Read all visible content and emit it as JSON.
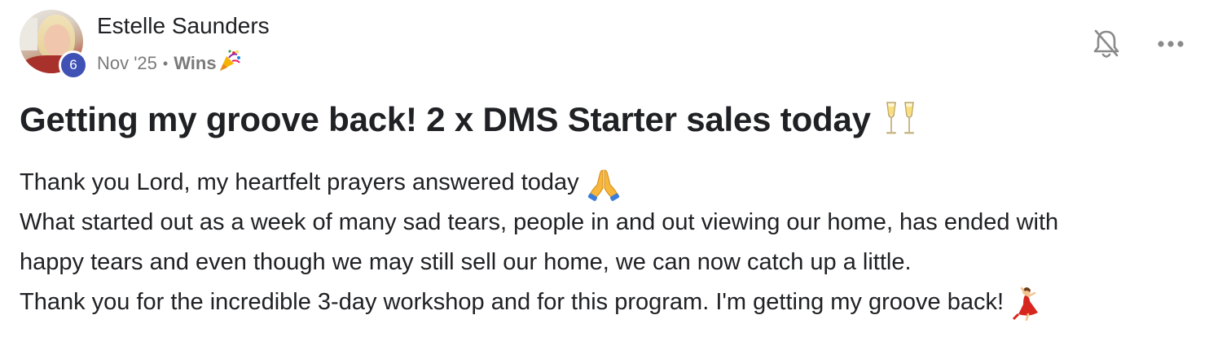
{
  "post": {
    "author": {
      "name": "Estelle Saunders",
      "level": "6"
    },
    "meta": {
      "date": "Nov '25",
      "separator": "•",
      "category": "Wins",
      "category_icon": "party-popper-icon"
    },
    "actions": {
      "notify_icon": "bell-off-icon",
      "more_icon": "more-horizontal-icon"
    },
    "title": "Getting my groove back! 2 x DMS Starter sales today",
    "title_icon": "champagne-glasses-icon",
    "body": {
      "line1": "Thank you Lord, my heartfelt prayers answered today",
      "line1_icon": "praying-hands-icon",
      "line2": "What started out as a week of many sad tears, people in and out viewing our home, has ended with",
      "line3": "happy tears and even though we may still sell our home, we can now catch up a little.",
      "line4": "Thank you for the incredible 3-day workshop and for this program. I'm getting my groove back!",
      "line4_icon": "dancer-icon"
    }
  },
  "colors": {
    "text": "#202124",
    "meta_text": "#7a7a7a",
    "level_badge": "#3f51b5",
    "icon_gray": "#8a8a8a"
  }
}
